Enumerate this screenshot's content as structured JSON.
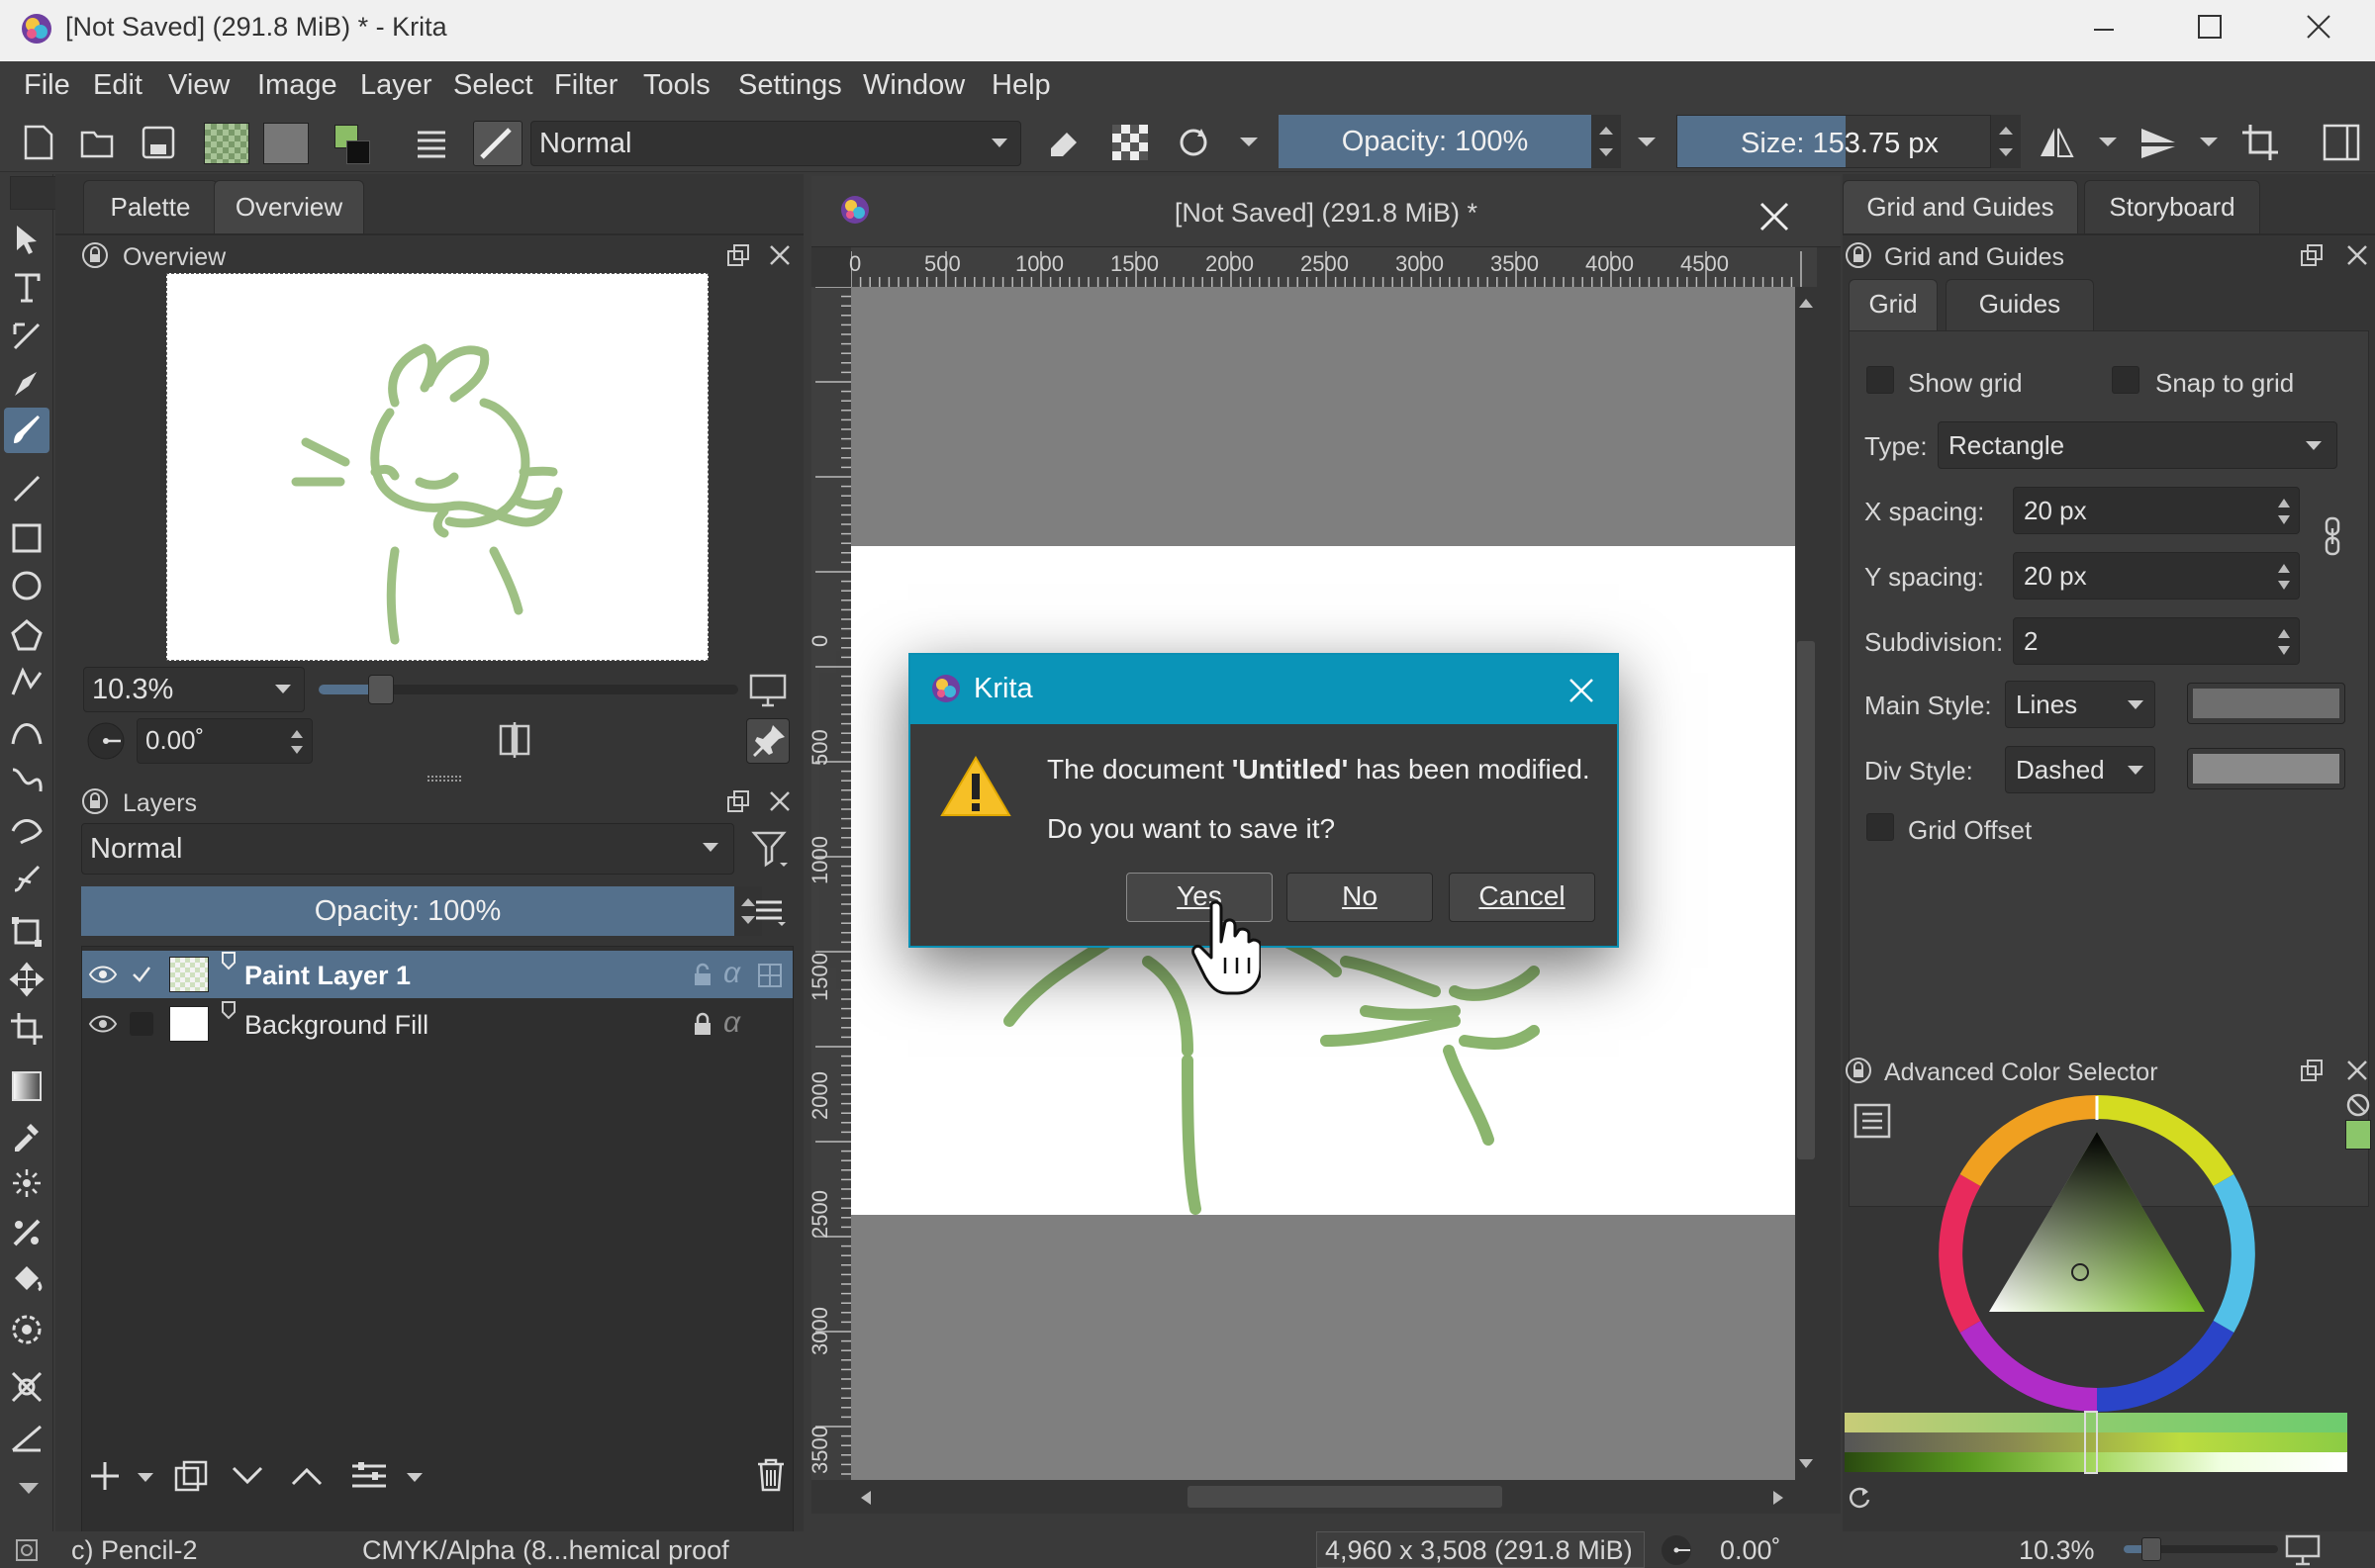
{
  "window": {
    "title": "[Not Saved]  (291.8 MiB) * - Krita"
  },
  "menu": [
    "File",
    "Edit",
    "View",
    "Image",
    "Layer",
    "Select",
    "Filter",
    "Tools",
    "Settings",
    "Window",
    "Help"
  ],
  "toolbar": {
    "blend_mode": "Normal",
    "opacity": "Opacity: 100%",
    "size": "Size: 153.75 px"
  },
  "left_docker": {
    "tabs": [
      "Palette",
      "Overview"
    ],
    "overview": {
      "title": "Overview",
      "zoom": "10.3%",
      "rotation": "0.00˚"
    },
    "layers": {
      "title": "Layers",
      "blend_mode": "Normal",
      "opacity": "Opacity:  100%",
      "items": [
        {
          "name": "Paint Layer 1",
          "selected": true
        },
        {
          "name": "Background Fill",
          "selected": false
        }
      ]
    }
  },
  "document": {
    "title": "[Not Saved]  (291.8 MiB) *",
    "ruler_x": [
      "0",
      "500",
      "1000",
      "1500",
      "2000",
      "2500",
      "3000",
      "3500",
      "4000",
      "4500"
    ],
    "ruler_y": [
      "0",
      "500",
      "1000",
      "1500",
      "2000",
      "2500",
      "3000",
      "3500"
    ]
  },
  "dialog": {
    "title": "Krita",
    "message_pre": "The document ",
    "message_name": "'Untitled'",
    "message_post": " has been modified.",
    "question": "Do you want to save it?",
    "buttons": {
      "yes": "Yes",
      "no": "No",
      "cancel": "Cancel"
    }
  },
  "right_docker": {
    "tabs": [
      "Grid and Guides",
      "Storyboard"
    ],
    "grid": {
      "title": "Grid and Guides",
      "subtabs": [
        "Grid",
        "Guides"
      ],
      "show_grid": "Show grid",
      "snap_to_grid": "Snap to grid",
      "type_label": "Type:",
      "type_value": "Rectangle",
      "x_spacing_label": "X spacing:",
      "x_spacing": "20 px",
      "y_spacing_label": "Y spacing:",
      "y_spacing": "20 px",
      "subdivision_label": "Subdivision:",
      "subdivision": "2",
      "main_style_label": "Main Style:",
      "main_style": "Lines",
      "div_style_label": "Div Style:",
      "div_style": "Dashed",
      "grid_offset": "Grid Offset"
    },
    "color_selector": {
      "title": "Advanced Color Selector"
    }
  },
  "status": {
    "brush": "c) Pencil-2",
    "color_space": "CMYK/Alpha (8...hemical proof",
    "dimensions": "4,960 x 3,508 (291.8 MiB)",
    "rotation": "0.00˚",
    "zoom": "10.3%"
  },
  "colors": {
    "accent": "#0a94b8",
    "selection": "#54708c",
    "stroke": "#8bb56e"
  }
}
